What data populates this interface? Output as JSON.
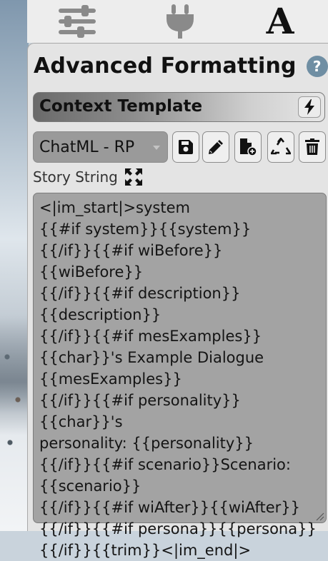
{
  "top_tabs": [
    {
      "icon": "sliders-icon"
    },
    {
      "icon": "plug-icon"
    },
    {
      "icon": "font-a-icon",
      "label": "A"
    }
  ],
  "header": {
    "title": "Advanced Formatting",
    "help_icon": "question-circle-icon",
    "help_glyph": "?"
  },
  "context_template": {
    "title": "Context Template",
    "bolt_icon": "bolt-icon",
    "preset_value": "ChatML - RP",
    "actions": [
      "save-icon",
      "pencil-icon",
      "file-add-icon",
      "recycle-icon",
      "trash-icon"
    ]
  },
  "story_string": {
    "label": "Story String",
    "expand_icon": "expand-arrows-icon",
    "value": "<|im_start|>system\n{{#if system}}{{system}}\n{{/if}}{{#if wiBefore}}{{wiBefore}}\n{{/if}}{{#if description}}\n{{description}}\n{{/if}}{{#if mesExamples}}\n{{char}}'s Example Dialogue\n{{mesExamples}}\n{{/if}}{{#if personality}}{{char}}'s\npersonality: {{personality}}\n{{/if}}{{#if scenario}}Scenario:\n{{scenario}}\n{{/if}}{{#if wiAfter}}{{wiAfter}}\n{{/if}}{{#if persona}}{{persona}}\n{{/if}}{{trim}}<|im_end|>"
  },
  "colors": {
    "panel_bg": "#e4e4e4",
    "help_icon_bg": "#6f8ea3",
    "textarea_bg": "#a3a3a3",
    "select_bg": "#9a9a9a"
  }
}
